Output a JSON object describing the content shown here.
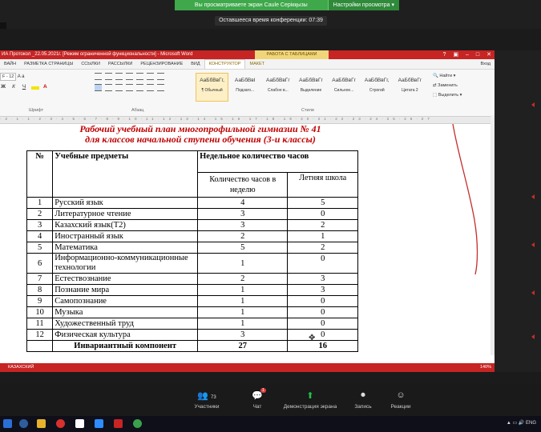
{
  "zoom": {
    "share_banner": "Вы просматриваете экран Саule Серікқызы",
    "view_options": "Настройки просмотра",
    "timer": "Оставшееся время конференции: 07:39",
    "participants_count": "73",
    "chat_badge": "1",
    "buttons": [
      "Участники",
      "Чат",
      "Демонстрация экрана",
      "Запись",
      "Реакции"
    ]
  },
  "word": {
    "title": "ИА Протокол _22.05.2021г. [Режим ограниченной функциональности] - Microsoft Word",
    "table_tools": "РАБОТА С ТАБЛИЦАМИ",
    "tabs": [
      "ВАЙН",
      "РАЗМЕТКА СТРАНИЦЫ",
      "ССЫЛКИ",
      "РАССЫЛКИ",
      "РЕЦЕНЗИРОВАНИЕ",
      "ВИД",
      "КОНСТРУКТОР",
      "МАКЕТ"
    ],
    "login": "Вход",
    "font_size": "F - 12",
    "groups": {
      "font": "Шрифт",
      "paragraph": "Абзац",
      "styles": "Стили"
    },
    "styles": [
      {
        "sample": "АаБбВвГг,",
        "name": "¶ Обычный"
      },
      {
        "sample": "АаБбВвІ",
        "name": "Подзаго..."
      },
      {
        "sample": "АаБбВвГг",
        "name": "Слабое в..."
      },
      {
        "sample": "АаБбВвГг",
        "name": "Выделение"
      },
      {
        "sample": "АаБбВвГг",
        "name": "Сильное..."
      },
      {
        "sample": "АаБбВвГг,",
        "name": "Строгий"
      },
      {
        "sample": "АаБбВвГг",
        "name": "Цитата 2"
      }
    ],
    "editing": [
      "Найти",
      "Заменить",
      "Выделить"
    ],
    "status_lang": "КАЗАХСКИЙ",
    "zoom_level": "140%"
  },
  "doc": {
    "title_line1": "Рабочий учебный план многопрофильной гимназии № 41",
    "title_line2": "для классов начальной ступени обучения (3-и классы)",
    "headers": {
      "num": "№",
      "subject": "Учебные предметы",
      "weekly": "Недельное количество часов",
      "hours": "Количество часов в неделю",
      "summer": "Летняя школа"
    },
    "rows": [
      {
        "n": "1",
        "subject": "Русский язык",
        "hours": "4",
        "summer": "5"
      },
      {
        "n": "2",
        "subject": "Литературное чтение",
        "hours": "3",
        "summer": "0"
      },
      {
        "n": "3",
        "subject": "Казахский язык(Т2)",
        "hours": "3",
        "summer": "2"
      },
      {
        "n": "4",
        "subject": "Иностранный язык",
        "hours": "2",
        "summer": "1"
      },
      {
        "n": "5",
        "subject": "Математика",
        "hours": "5",
        "summer": "2"
      },
      {
        "n": "6",
        "subject": "Информационно-коммуникационные технологии",
        "hours": "1",
        "summer": "0"
      },
      {
        "n": "7",
        "subject": "Естествознание",
        "hours": "2",
        "summer": "3"
      },
      {
        "n": "8",
        "subject": "Познание мира",
        "hours": "1",
        "summer": "3"
      },
      {
        "n": "9",
        "subject": "Самопознание",
        "hours": "1",
        "summer": "0"
      },
      {
        "n": "10",
        "subject": "Музыка",
        "hours": "1",
        "summer": "0"
      },
      {
        "n": "11",
        "subject": "Художественный труд",
        "hours": "1",
        "summer": "0"
      },
      {
        "n": "12",
        "subject": "Физическая культура",
        "hours": "3",
        "summer": "0"
      }
    ],
    "total": {
      "label": "Инвариантный компонент",
      "hours": "27",
      "summer": "16"
    }
  },
  "colors": {
    "word_red": "#c72424",
    "zoom_green": "#3ea84a",
    "title_red": "#c00000"
  }
}
